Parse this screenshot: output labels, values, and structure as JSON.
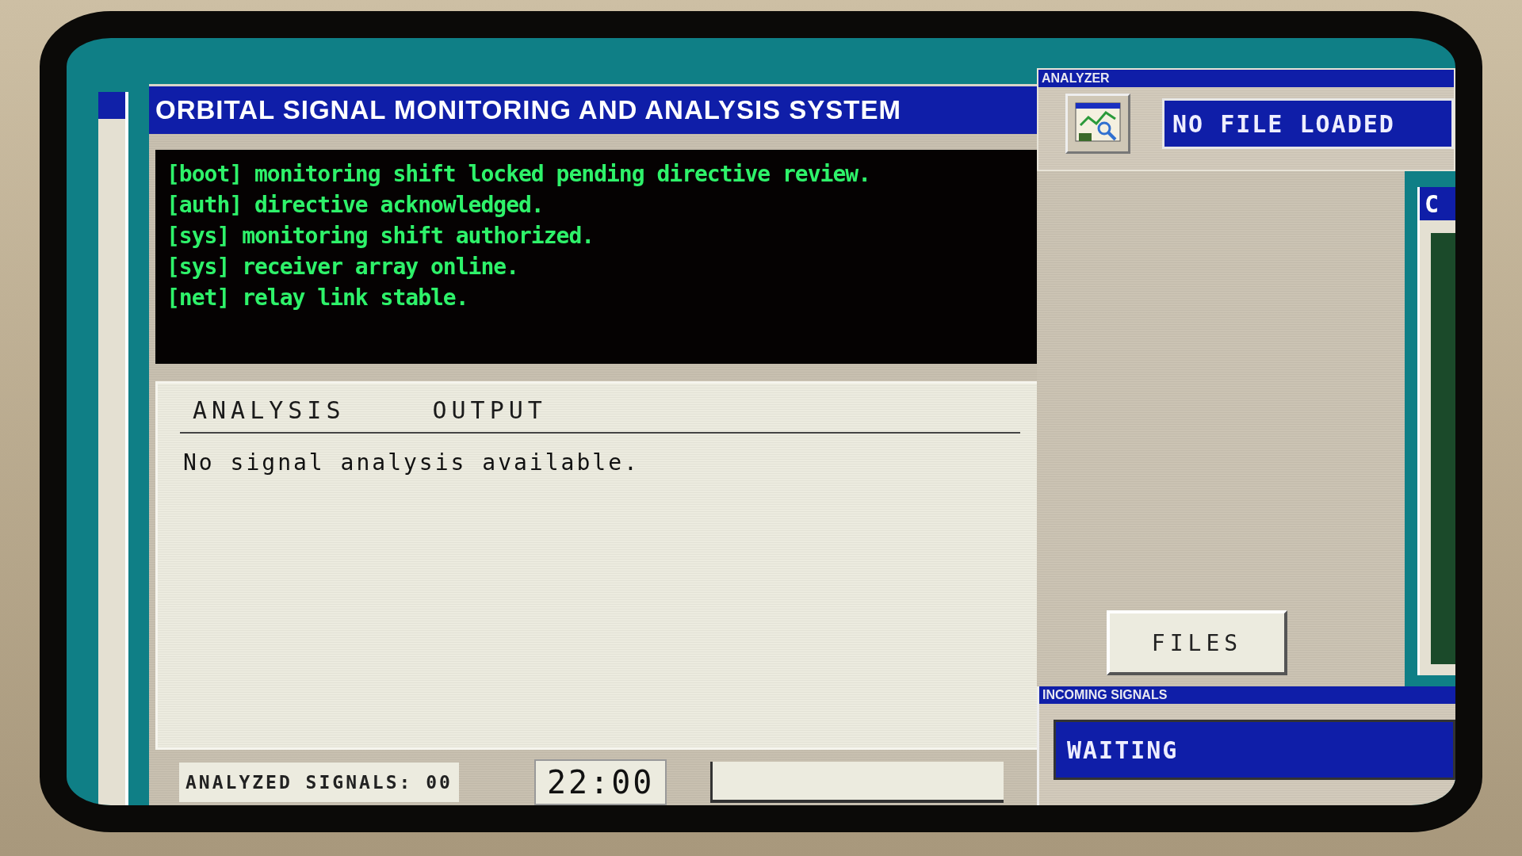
{
  "main_window": {
    "title": "ORBITAL SIGNAL MONITORING AND ANALYSIS SYSTEM"
  },
  "console": {
    "lines": [
      {
        "tag": "[boot]",
        "text": "monitoring shift locked pending directive review."
      },
      {
        "tag": "[auth]",
        "text": "directive acknowledged."
      },
      {
        "tag": "[sys]",
        "text": "monitoring shift authorized."
      },
      {
        "tag": "[sys]",
        "text": "receiver array online."
      },
      {
        "tag": "[net]",
        "text": "relay link stable."
      }
    ]
  },
  "analysis": {
    "columns": [
      "ANALYSIS",
      "OUTPUT"
    ],
    "message": "No signal analysis available."
  },
  "status_bar": {
    "analyzed_signals": "ANALYZED SIGNALS: 00",
    "clock": "22:00"
  },
  "analyzer": {
    "title": "ANALYZER",
    "status": "NO FILE LOADED"
  },
  "files_button": "FILES",
  "side_window": {
    "title": "C"
  },
  "incoming": {
    "title": "INCOMING SIGNALS",
    "status": "WAITING"
  }
}
